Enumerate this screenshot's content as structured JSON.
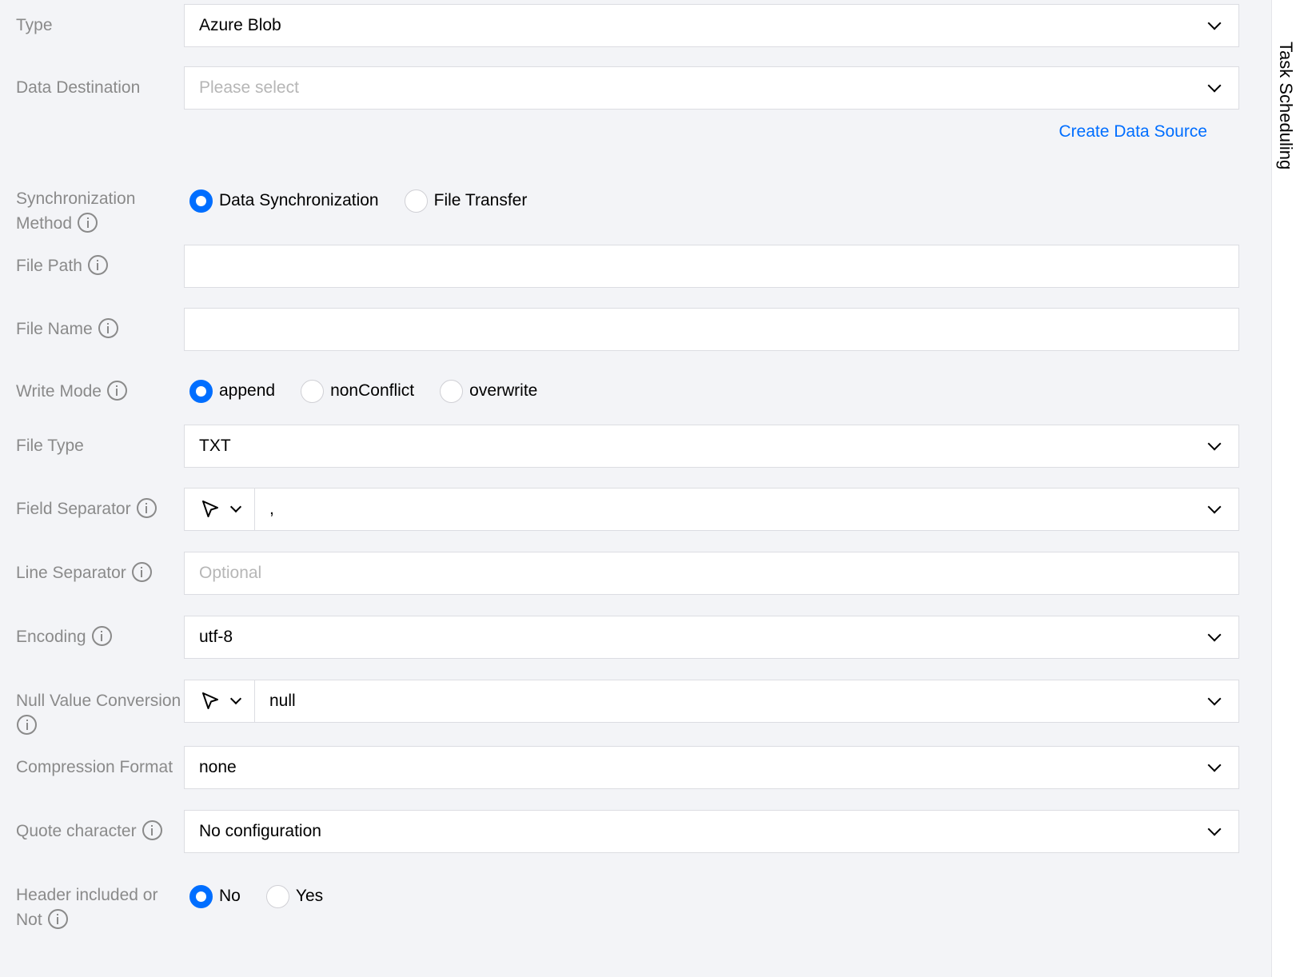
{
  "form": {
    "type": {
      "label": "Type",
      "value": "Azure Blob"
    },
    "data_destination": {
      "label": "Data Destination",
      "placeholder": "Please select"
    },
    "create_link": "Create Data Source",
    "sync_method": {
      "label_line1": "Synchronization",
      "label_line2": "Method",
      "options": [
        "Data Synchronization",
        "File Transfer"
      ],
      "selected": "Data Synchronization"
    },
    "file_path": {
      "label": "File Path",
      "value": ""
    },
    "file_name": {
      "label": "File Name",
      "value": ""
    },
    "write_mode": {
      "label": "Write Mode",
      "options": [
        "append",
        "nonConflict",
        "overwrite"
      ],
      "selected": "append"
    },
    "file_type": {
      "label": "File Type",
      "value": "TXT"
    },
    "field_separator": {
      "label": "Field Separator",
      "value": ","
    },
    "line_separator": {
      "label": "Line Separator",
      "placeholder": "Optional"
    },
    "encoding": {
      "label": "Encoding",
      "value": "utf-8"
    },
    "null_value_conversion": {
      "label": "Null Value Conversion",
      "value": "null"
    },
    "compression_format": {
      "label": "Compression Format",
      "value": "none"
    },
    "quote_character": {
      "label": "Quote character",
      "value": "No configuration"
    },
    "header_included": {
      "label_line1": "Header included or",
      "label_line2": "Not",
      "options": [
        "No",
        "Yes"
      ],
      "selected": "No"
    }
  },
  "sidebar": {
    "tab_label": "Task Scheduling"
  },
  "colors": {
    "accent": "#006eff",
    "label": "#8a8a8a",
    "background": "#f3f4f7"
  }
}
